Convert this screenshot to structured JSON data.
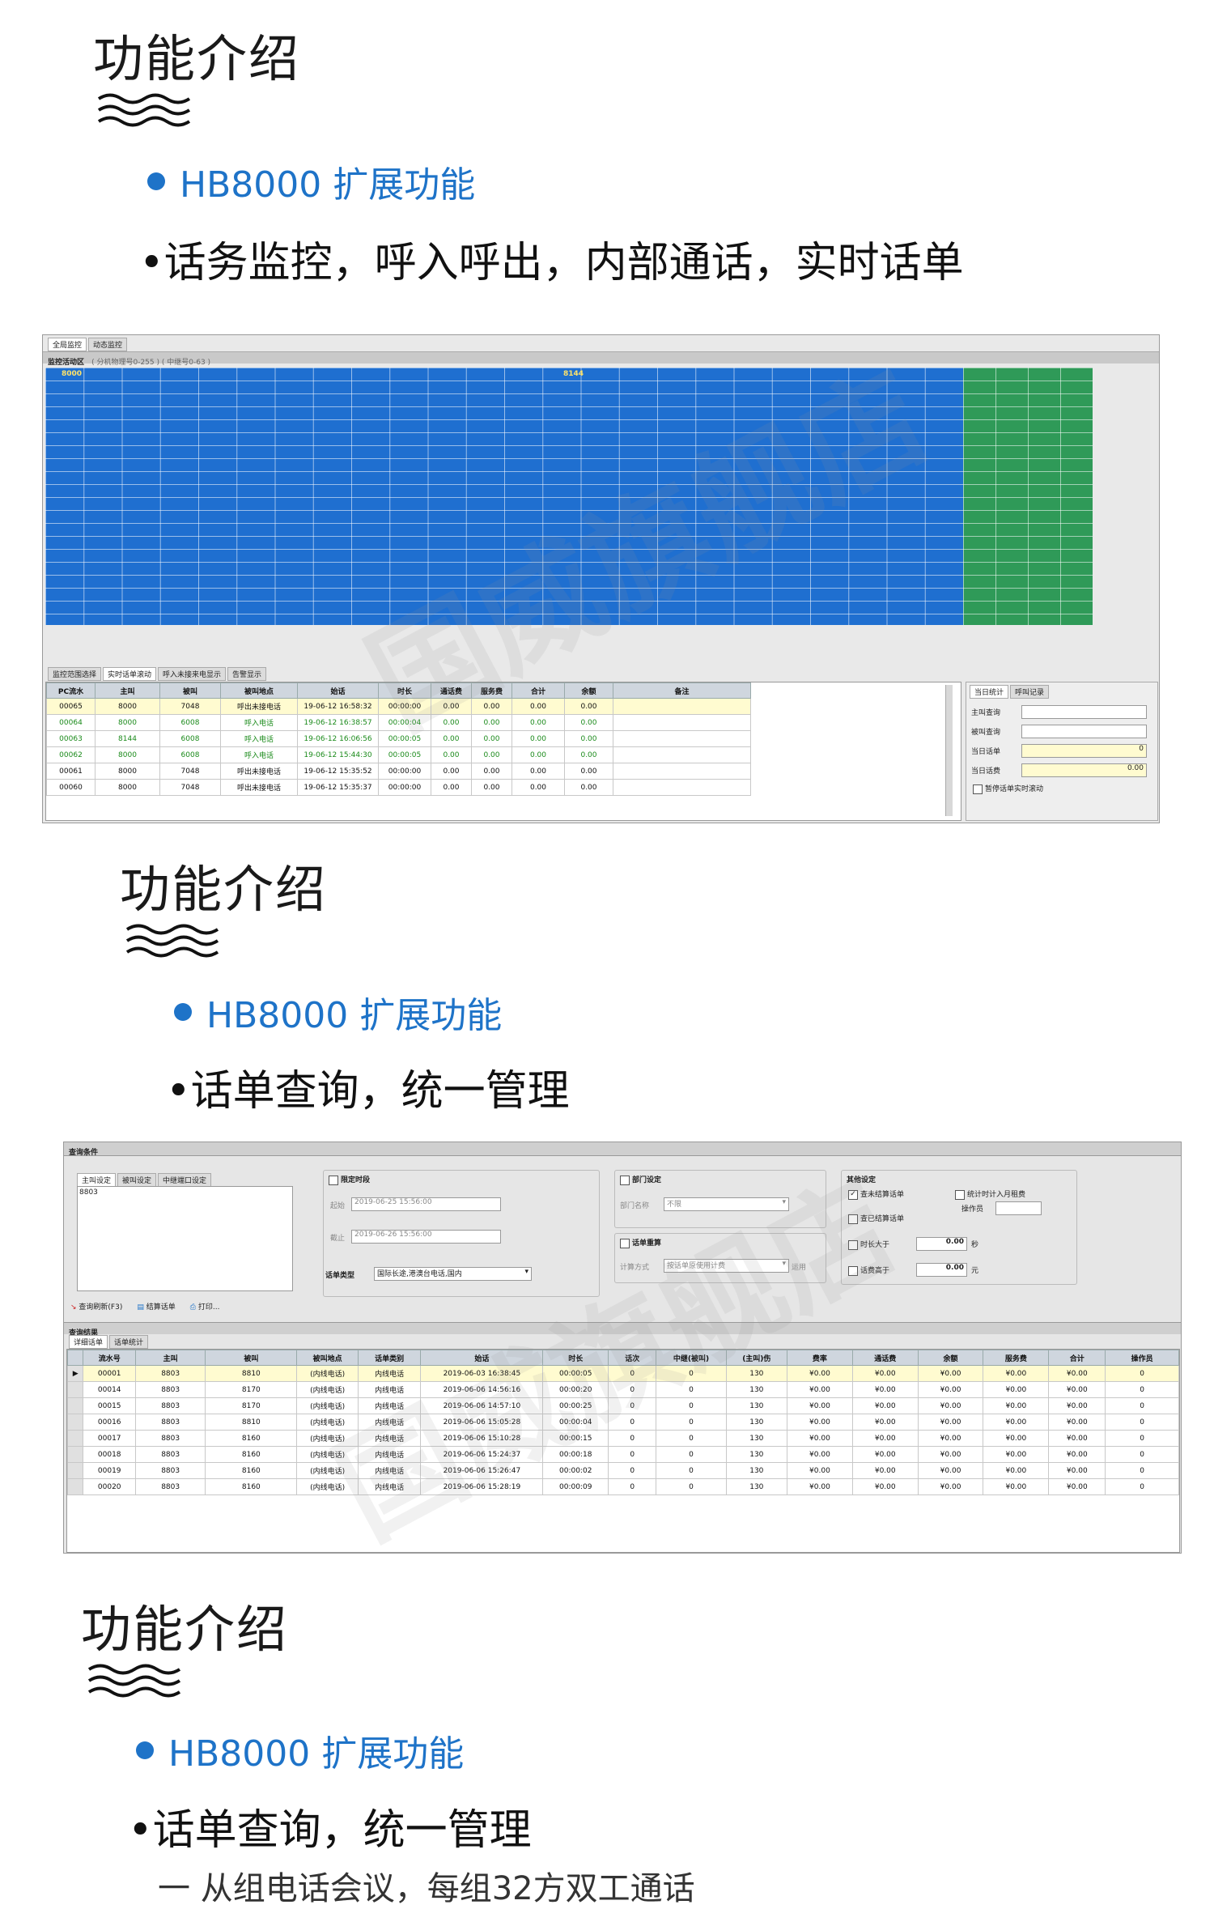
{
  "sections": [
    {
      "title": "功能介绍",
      "subtitle": "HB8000 扩展功能",
      "bullet": "•话务监控，呼入呼出，内部通话，实时话单"
    },
    {
      "title": "功能介绍",
      "subtitle": "HB8000 扩展功能",
      "bullet": "•话单查询，统一管理"
    },
    {
      "title": "功能介绍",
      "subtitle": "HB8000 扩展功能",
      "bullet": "•话单查询，统一管理",
      "partial_text": "一 从组电话会议，每组32方双工通话"
    }
  ],
  "watermark": "国威旗舰店",
  "colors": {
    "accent": "#1e73c8",
    "monitor_blue": "#1f6fd0",
    "monitor_green": "#2f9a58"
  },
  "monitor": {
    "tabs": [
      "全局监控",
      "动态监控"
    ],
    "area_label": "监控活动区",
    "area_hint": "( 分机物理号0-255 ) ( 中继号0-63 )",
    "cell_label_1": "8000",
    "cell_label_2": "8144",
    "bottom_tabs": [
      "监控范围选择",
      "实时话单滚动",
      "呼入未接来电显示",
      "告警显示"
    ],
    "columns": [
      "PC流水",
      "主叫",
      "被叫",
      "被叫地点",
      "始话",
      "时长",
      "通话费",
      "服务费",
      "合计",
      "余额",
      "备注"
    ],
    "rows": [
      [
        "00065",
        "8000",
        "7048",
        "呼出未接电话",
        "19-06-12 16:58:32",
        "00:00:00",
        "0.00",
        "0.00",
        "0.00",
        "0.00",
        ""
      ],
      [
        "00064",
        "8000",
        "6008",
        "呼入电话",
        "19-06-12 16:38:57",
        "00:00:04",
        "0.00",
        "0.00",
        "0.00",
        "0.00",
        ""
      ],
      [
        "00063",
        "8144",
        "6008",
        "呼入电话",
        "19-06-12 16:06:56",
        "00:00:05",
        "0.00",
        "0.00",
        "0.00",
        "0.00",
        ""
      ],
      [
        "00062",
        "8000",
        "6008",
        "呼入电话",
        "19-06-12 15:44:30",
        "00:00:05",
        "0.00",
        "0.00",
        "0.00",
        "0.00",
        ""
      ],
      [
        "00061",
        "8000",
        "7048",
        "呼出未接电话",
        "19-06-12 15:35:52",
        "00:00:00",
        "0.00",
        "0.00",
        "0.00",
        "0.00",
        ""
      ],
      [
        "00060",
        "8000",
        "7048",
        "呼出未接电话",
        "19-06-12 15:35:37",
        "00:00:00",
        "0.00",
        "0.00",
        "0.00",
        "0.00",
        ""
      ]
    ],
    "side_tabs": [
      "当日统计",
      "呼叫记录"
    ],
    "side_fields": [
      {
        "label": "主叫查询",
        "value": ""
      },
      {
        "label": "被叫查询",
        "value": ""
      },
      {
        "label": "当日话单",
        "value": "0"
      },
      {
        "label": "当日话费",
        "value": "0.00"
      }
    ],
    "side_checkbox": "暂停话单实时滚动"
  },
  "query": {
    "title": "查询条件",
    "tabs": [
      "主叫设定",
      "被叫设定",
      "中继端口设定"
    ],
    "caller_value": "8803",
    "time_group": "限定时段",
    "start_label": "起始",
    "start_value": "2019-06-25  15:56:00",
    "end_label": "截止",
    "end_value": "2019-06-26  15:56:00",
    "type_label": "话单类型",
    "type_value": "国际长途,港澳台电话,国内",
    "dept_group": "部门设定",
    "dept_label": "部门名称",
    "dept_value": "不限",
    "recalc_group": "话单重算",
    "recalc_label": "计算方式",
    "recalc_value": "按话单原使用计费",
    "recalc_btn": "运用",
    "other_group": "其他设定",
    "opt_unsettled": "查未结算话单",
    "opt_monthly": "统计时计入月租费",
    "opt_settled": "查已结算话单",
    "operator_label": "操作员",
    "opt_duration": "时长大于",
    "duration_value": "0.00",
    "duration_unit": "秒",
    "opt_fee": "话费高于",
    "fee_value": "0.00",
    "fee_unit": "元",
    "toolbar": [
      "查询刷新(F3)",
      "结算话单",
      "打印..."
    ],
    "results_title": "查询结果",
    "result_tabs": [
      "详细话单",
      "话单统计"
    ],
    "columns": [
      "流水号",
      "主叫",
      "被叫",
      "被叫地点",
      "话单类别",
      "始话",
      "时长",
      "话次",
      "中继(被叫)",
      "(主叫)伤",
      "费率",
      "通话费",
      "余额",
      "服务费",
      "合计",
      "操作员"
    ],
    "rows": [
      [
        "00001",
        "8803",
        "8810",
        "(内线电话)",
        "内线电话",
        "2019-06-03 16:38:45",
        "00:00:05",
        "0",
        "0",
        "130",
        "¥0.00",
        "¥0.00",
        "¥0.00",
        "¥0.00",
        "¥0.00",
        "0"
      ],
      [
        "00014",
        "8803",
        "8170",
        "(内线电话)",
        "内线电话",
        "2019-06-06 14:56:16",
        "00:00:20",
        "0",
        "0",
        "130",
        "¥0.00",
        "¥0.00",
        "¥0.00",
        "¥0.00",
        "¥0.00",
        "0"
      ],
      [
        "00015",
        "8803",
        "8170",
        "(内线电话)",
        "内线电话",
        "2019-06-06 14:57:10",
        "00:00:25",
        "0",
        "0",
        "130",
        "¥0.00",
        "¥0.00",
        "¥0.00",
        "¥0.00",
        "¥0.00",
        "0"
      ],
      [
        "00016",
        "8803",
        "8810",
        "(内线电话)",
        "内线电话",
        "2019-06-06 15:05:28",
        "00:00:04",
        "0",
        "0",
        "130",
        "¥0.00",
        "¥0.00",
        "¥0.00",
        "¥0.00",
        "¥0.00",
        "0"
      ],
      [
        "00017",
        "8803",
        "8160",
        "(内线电话)",
        "内线电话",
        "2019-06-06 15:10:28",
        "00:00:15",
        "0",
        "0",
        "130",
        "¥0.00",
        "¥0.00",
        "¥0.00",
        "¥0.00",
        "¥0.00",
        "0"
      ],
      [
        "00018",
        "8803",
        "8160",
        "(内线电话)",
        "内线电话",
        "2019-06-06 15:24:37",
        "00:00:18",
        "0",
        "0",
        "130",
        "¥0.00",
        "¥0.00",
        "¥0.00",
        "¥0.00",
        "¥0.00",
        "0"
      ],
      [
        "00019",
        "8803",
        "8160",
        "(内线电话)",
        "内线电话",
        "2019-06-06 15:26:47",
        "00:00:02",
        "0",
        "0",
        "130",
        "¥0.00",
        "¥0.00",
        "¥0.00",
        "¥0.00",
        "¥0.00",
        "0"
      ],
      [
        "00020",
        "8803",
        "8160",
        "(内线电话)",
        "内线电话",
        "2019-06-06 15:28:19",
        "00:00:09",
        "0",
        "0",
        "130",
        "¥0.00",
        "¥0.00",
        "¥0.00",
        "¥0.00",
        "¥0.00",
        "0"
      ]
    ]
  }
}
